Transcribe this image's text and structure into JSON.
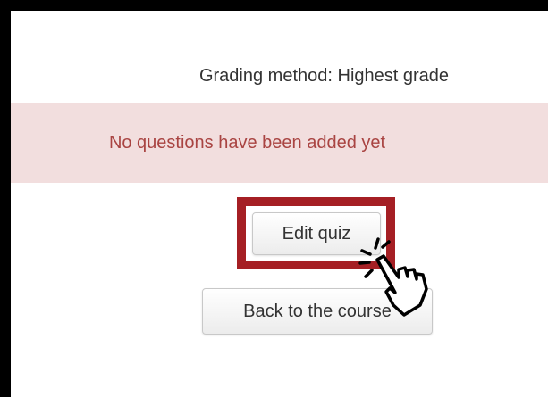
{
  "quiz": {
    "grading_method_text": "Grading method: Highest grade"
  },
  "alert": {
    "message": "No questions have been added yet"
  },
  "buttons": {
    "edit_quiz_label": "Edit quiz",
    "back_to_course_label": "Back to the course"
  },
  "colors": {
    "alert_background": "#f2dede",
    "alert_text": "#a94442",
    "highlight_border": "#a51f24",
    "frame_border": "#000000"
  },
  "icons": {
    "cursor": "hand-pointer-cursor-icon"
  }
}
